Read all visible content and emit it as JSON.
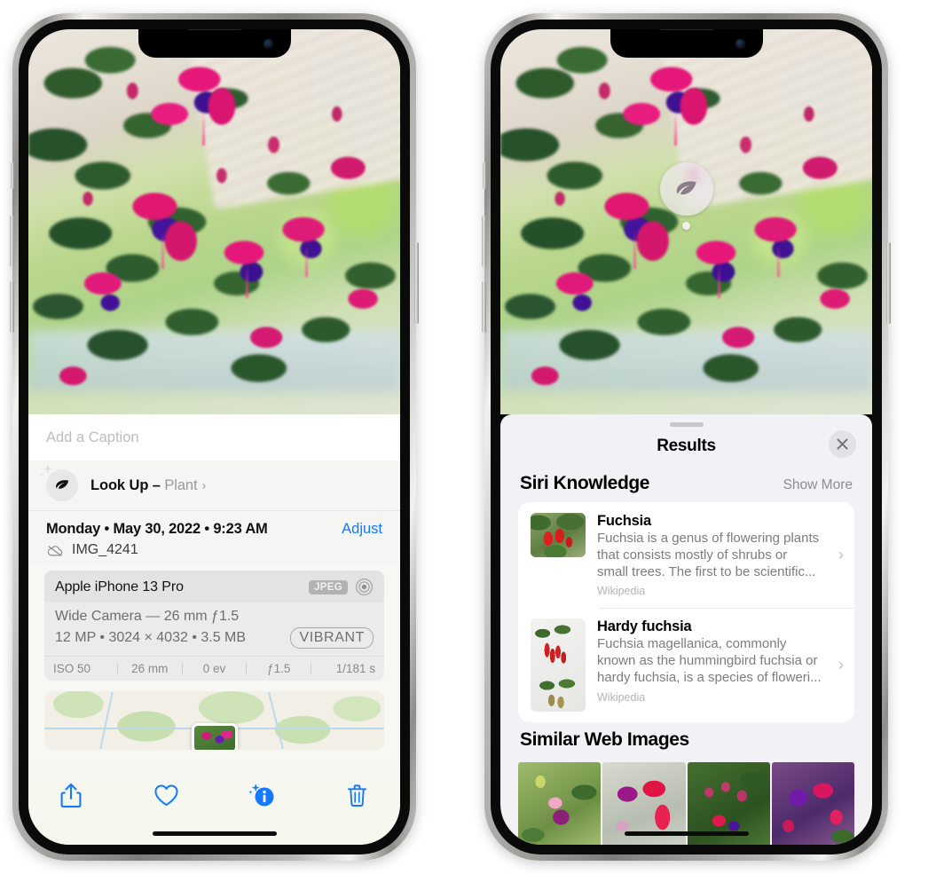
{
  "left_phone": {
    "caption_placeholder": "Add a Caption",
    "lookup": {
      "icon": "leaf-icon",
      "label": "Look Up – ",
      "subject": "Plant",
      "chevron": "›"
    },
    "meta": {
      "date": "Monday • May 30, 2022 • 9:23 AM",
      "adjust_label": "Adjust",
      "filename": "IMG_4241",
      "cloud_icon": "cloud-slash-icon"
    },
    "exif": {
      "model": "Apple iPhone 13 Pro",
      "format_badge": "JPEG",
      "lens_icon": "aperture-icon",
      "lens_line": "Wide Camera — 26 mm ƒ1.5",
      "specs_line": "12 MP • 3024 × 4032 • 3.5 MB",
      "style_badge": "VIBRANT",
      "footer": [
        "ISO 50",
        "26 mm",
        "0 ev",
        "ƒ1.5",
        "1/181 s"
      ]
    },
    "toolbar": [
      {
        "name": "share-button",
        "icon": "share-icon"
      },
      {
        "name": "favorite-button",
        "icon": "heart-icon"
      },
      {
        "name": "info-button",
        "icon": "info-sparkle-icon"
      },
      {
        "name": "delete-button",
        "icon": "trash-icon"
      }
    ],
    "accent_color": "#1479ff"
  },
  "right_phone": {
    "photo_badge": {
      "icon": "leaf-icon",
      "name": "visual-lookup-badge"
    },
    "sheet": {
      "title": "Results",
      "close_icon": "close-icon",
      "sections": [
        {
          "title": "Siri Knowledge",
          "action": "Show More",
          "items": [
            {
              "title": "Fuchsia",
              "description": "Fuchsia is a genus of flowering plants that consists mostly of shrubs or small trees. The first to be scientific...",
              "source": "Wikipedia",
              "chevron": "›"
            },
            {
              "title": "Hardy fuchsia",
              "description": "Fuchsia magellanica, commonly known as the hummingbird fuchsia or hardy fuchsia, is a species of floweri...",
              "source": "Wikipedia",
              "chevron": "›"
            }
          ]
        },
        {
          "title": "Similar Web Images",
          "images": [
            "web-image-1",
            "web-image-2",
            "web-image-3",
            "web-image-4"
          ]
        }
      ]
    }
  }
}
